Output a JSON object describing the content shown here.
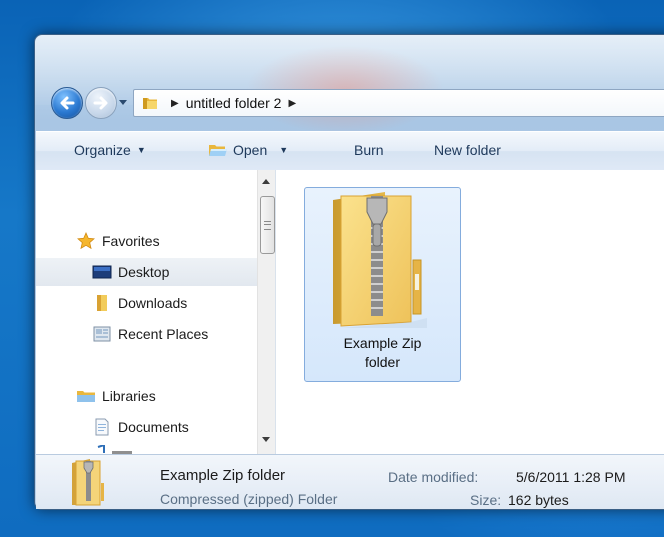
{
  "address_bar": {
    "crumbs": [
      "untitled folder 2"
    ]
  },
  "toolbar": {
    "organize_label": "Organize",
    "open_label": "Open",
    "burn_label": "Burn",
    "new_folder_label": "New folder"
  },
  "nav_pane": {
    "favorites_label": "Favorites",
    "items": [
      {
        "label": "Desktop",
        "icon": "desktop-icon",
        "selected": true
      },
      {
        "label": "Downloads",
        "icon": "folder-icon"
      },
      {
        "label": "Recent Places",
        "icon": "recent-places-icon"
      }
    ],
    "libraries_label": "Libraries",
    "library_items": [
      {
        "label": "Documents",
        "icon": "documents-icon"
      }
    ]
  },
  "content": {
    "file_name_line1": "Example Zip",
    "file_name_line2": "folder"
  },
  "details": {
    "name": "Example Zip folder",
    "type": "Compressed (zipped) Folder",
    "date_modified_label": "Date modified:",
    "date_modified_value": "5/6/2011 1:28 PM",
    "size_label": "Size:",
    "size_value": "162 bytes"
  },
  "colors": {
    "selection_fill": "#d5e7fb",
    "selection_border": "#84acdd",
    "toolbar_text": "#1e395b",
    "folder_yellow": "#f2cc5b"
  }
}
